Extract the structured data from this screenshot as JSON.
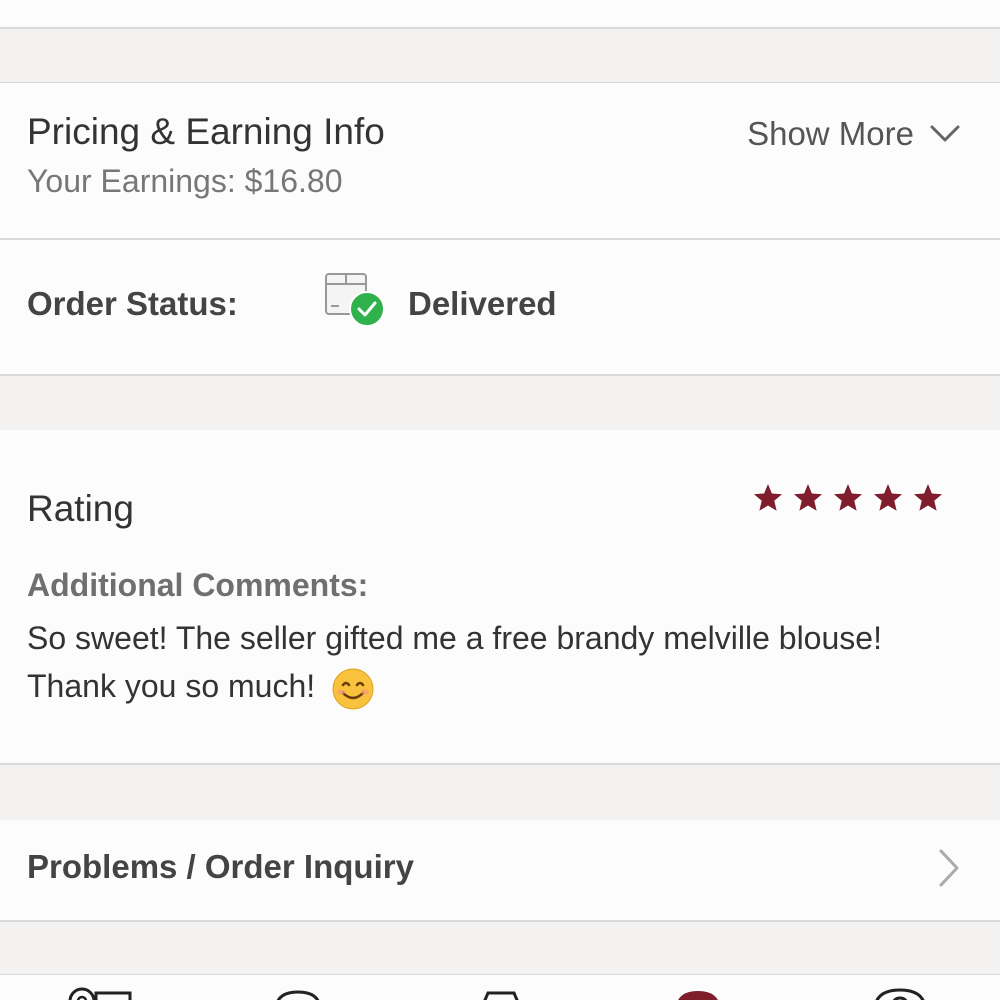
{
  "pricing": {
    "title": "Pricing & Earning Info",
    "earnings": "Your Earnings: $16.80",
    "show_more": "Show More"
  },
  "order_status": {
    "label": "Order Status:",
    "value": "Delivered",
    "icon": "package-delivered-icon"
  },
  "rating": {
    "title": "Rating",
    "stars": 5,
    "max_stars": 5,
    "comments_label": "Additional Comments:",
    "comment": "So sweet! The seller gifted me a free brandy melville blouse! Thank you so much!"
  },
  "problems": {
    "label": "Problems / Order Inquiry"
  },
  "colors": {
    "accent": "#7f1d2d",
    "success": "#2fb24c",
    "background": "#f3f2f1",
    "card": "#fdfcfc"
  },
  "bottom_nav": {
    "icons": [
      "tag-icon",
      "chat-icon",
      "bag-icon",
      "sell-icon",
      "profile-icon"
    ]
  }
}
